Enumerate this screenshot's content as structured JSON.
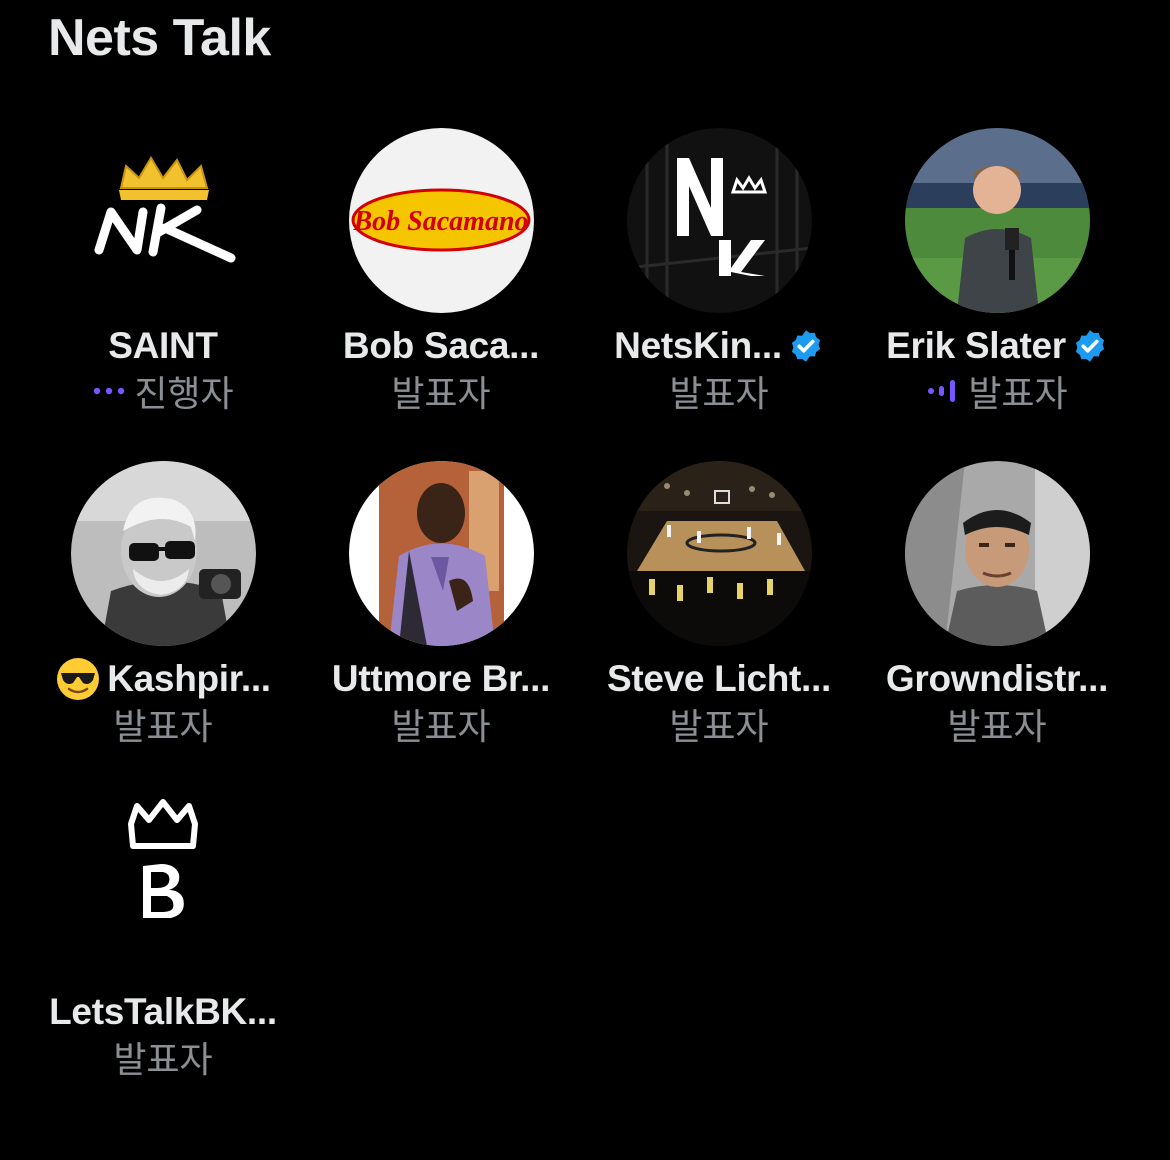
{
  "space": {
    "title": "Nets Talk"
  },
  "colors": {
    "background": "#000000",
    "text": "#e7e9ea",
    "muted": "#8b8f94",
    "accent_purple": "#7856ff",
    "verified_blue": "#1d9bf0"
  },
  "speakers": [
    {
      "name": "SAINT",
      "role": "진행자",
      "status_icon": "speaking-dots-icon",
      "verified": false,
      "avatar": "nk-crown-logo"
    },
    {
      "name": "Bob Saca...",
      "role": "발표자",
      "verified": false,
      "avatar": "bob-sacamano-logo",
      "avatar_text": "Bob Sacamano"
    },
    {
      "name": "NetsKin...",
      "role": "발표자",
      "verified": true,
      "avatar": "nk-bridge-logo"
    },
    {
      "name": "Erik Slater",
      "role": "발표자",
      "status_icon": "audio-wave-icon",
      "verified": true,
      "avatar": "stadium-reporter-photo"
    },
    {
      "name": "Kashpir...",
      "role": "발표자",
      "verified": false,
      "emoji_icon": "sunglasses-emoji-icon",
      "avatar": "man-camera-photo"
    },
    {
      "name": "Uttmore Br...",
      "role": "발표자",
      "verified": false,
      "avatar": "man-purple-shirt-photo"
    },
    {
      "name": "Steve Licht...",
      "role": "발표자",
      "verified": false,
      "avatar": "basketball-arena-photo"
    },
    {
      "name": "Growndistr...",
      "role": "발표자",
      "verified": false,
      "avatar": "man-car-selfie-photo"
    },
    {
      "name": "LetsTalkBK...",
      "role": "발표자",
      "verified": false,
      "avatar": "crown-b-logo"
    }
  ]
}
